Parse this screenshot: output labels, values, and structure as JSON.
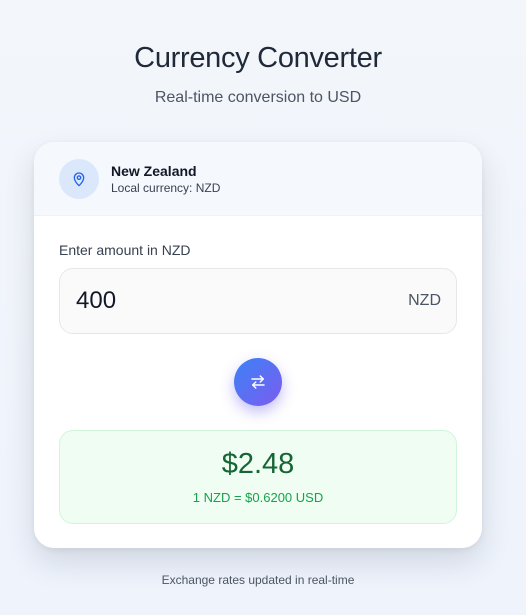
{
  "header": {
    "title": "Currency Converter",
    "subtitle": "Real-time conversion to USD"
  },
  "location": {
    "icon": "map-pin-icon",
    "country": "New Zealand",
    "currency_text": "Local currency: NZD"
  },
  "amount": {
    "label": "Enter amount in NZD",
    "value": "400",
    "currency_code": "NZD"
  },
  "swap": {
    "icon": "swap-arrows-icon"
  },
  "result": {
    "converted": "$2.48",
    "rate": "1 NZD = $0.6200 USD"
  },
  "footer": {
    "note": "Exchange rates updated in real-time"
  },
  "colors": {
    "accent_start": "#3b82f6",
    "accent_end": "#7c5cf0",
    "result_text": "#166534",
    "rate_text": "#16a34a",
    "result_bg": "#effdf3"
  }
}
